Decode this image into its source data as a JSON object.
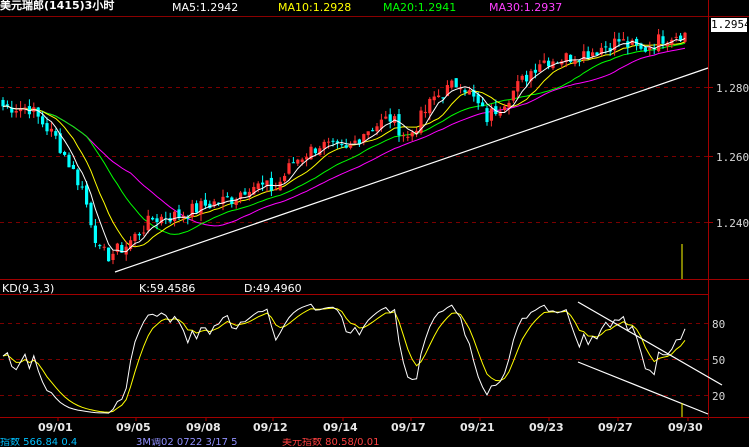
{
  "header": {
    "instrument": "美元瑞郎(1415)3小时",
    "ma5": "MA5:1.2942",
    "ma10": "MA10:1.2928",
    "ma20": "MA20:1.2941",
    "ma30": "MA30:1.2937"
  },
  "colors": {
    "ma5": "#ffffff",
    "ma10": "#ffff00",
    "ma20": "#00ff00",
    "ma30": "#ff00ff",
    "up_candle": "#ff3030",
    "down_candle": "#00ffff",
    "grid": "#8b0000",
    "volume_bar": "#ffff00"
  },
  "price_panel": {
    "current_price": "1.2954",
    "y_labels": [
      "1.2800",
      "1.2600",
      "1.2400"
    ]
  },
  "kd_panel": {
    "label": "KD(9,3,3)",
    "k": "K:59.4586",
    "d": "D:49.4960",
    "y_labels": [
      "80",
      "50",
      "20"
    ]
  },
  "x_labels": [
    "09/01",
    "09/05",
    "09/08",
    "09/12",
    "09/14",
    "09/17",
    "09/21",
    "09/23",
    "09/27",
    "09/30"
  ],
  "bottom_strip": {
    "left_text": "指数 566.84 0.4",
    "mid_text": "3M调02 0722 3/17 5",
    "right_text": "美元指数 80.58/0.01"
  },
  "chart_data": [
    {
      "type": "candlestick",
      "title": "美元瑞郎(1415)3小时",
      "ylim": [
        1.222,
        1.2998
      ],
      "y_ticks": [
        1.24,
        1.26,
        1.28
      ],
      "last_price": 1.2954,
      "ma": {
        "MA5": 1.2942,
        "MA10": 1.2928,
        "MA20": 1.2941,
        "MA30": 1.2937
      },
      "x_ticks": [
        "09/01",
        "09/05",
        "09/08",
        "09/12",
        "09/14",
        "09/17",
        "09/21",
        "09/23",
        "09/27",
        "09/30"
      ],
      "close_path": [
        [
          0,
          1.2735
        ],
        [
          6,
          1.273
        ],
        [
          12,
          1.264
        ],
        [
          18,
          1.249
        ],
        [
          22,
          1.23
        ],
        [
          24,
          1.229
        ],
        [
          28,
          1.232
        ],
        [
          34,
          1.24
        ],
        [
          40,
          1.241
        ],
        [
          46,
          1.244
        ],
        [
          52,
          1.246
        ],
        [
          56,
          1.25
        ],
        [
          62,
          1.249
        ],
        [
          66,
          1.257
        ],
        [
          72,
          1.262
        ],
        [
          78,
          1.26
        ],
        [
          82,
          1.266
        ],
        [
          88,
          1.27
        ],
        [
          92,
          1.264
        ],
        [
          98,
          1.276
        ],
        [
          104,
          1.281
        ],
        [
          110,
          1.27
        ],
        [
          116,
          1.278
        ],
        [
          122,
          1.287
        ],
        [
          128,
          1.288
        ],
        [
          134,
          1.29
        ],
        [
          140,
          1.293
        ],
        [
          145,
          1.29
        ],
        [
          150,
          1.294
        ],
        [
          154,
          1.2954
        ]
      ],
      "trend_line": {
        "from": [
          25,
          1.228
        ],
        "to": [
          159,
          1.2862
        ]
      }
    },
    {
      "type": "line",
      "title": "KD(9,3,3)",
      "ylim": [
        0,
        100
      ],
      "y_ticks": [
        20,
        50,
        80
      ],
      "series": [
        {
          "name": "K",
          "last": 59.4586
        },
        {
          "name": "D",
          "last": 49.496
        }
      ]
    }
  ]
}
